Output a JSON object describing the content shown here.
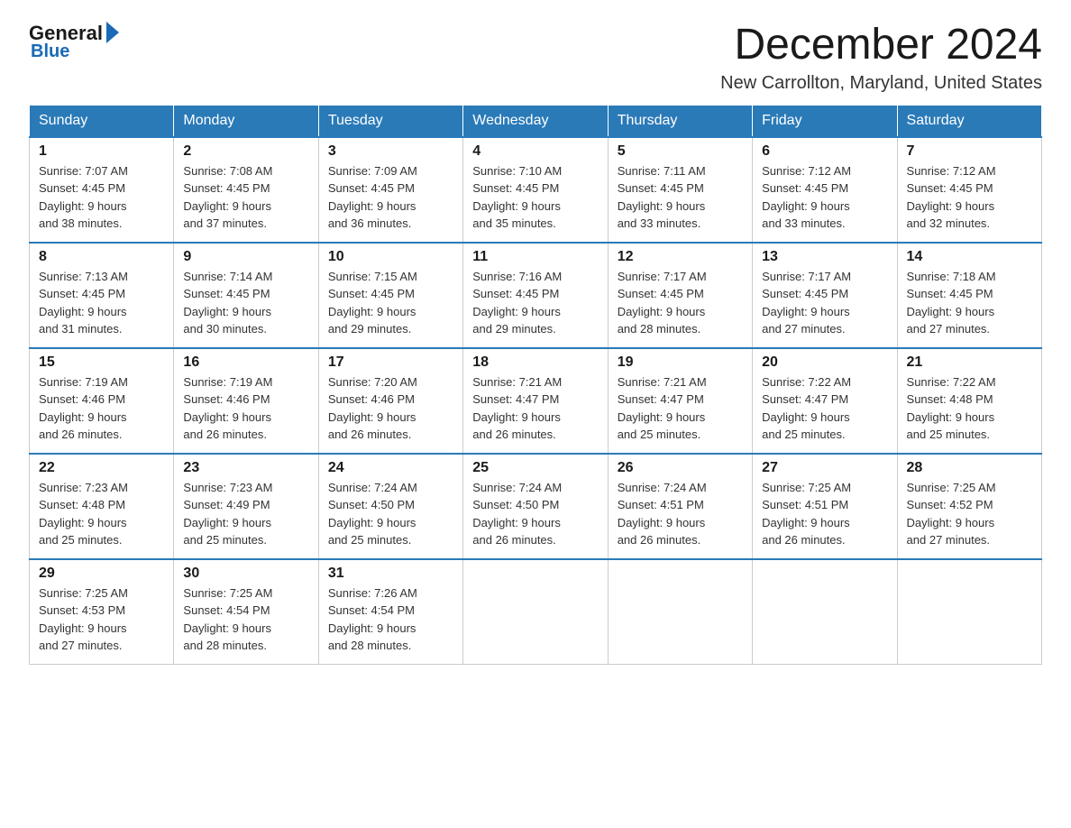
{
  "logo": {
    "general": "General",
    "blue": "Blue"
  },
  "header": {
    "month": "December 2024",
    "location": "New Carrollton, Maryland, United States"
  },
  "weekdays": [
    "Sunday",
    "Monday",
    "Tuesday",
    "Wednesday",
    "Thursday",
    "Friday",
    "Saturday"
  ],
  "weeks": [
    [
      {
        "day": "1",
        "sunrise": "7:07 AM",
        "sunset": "4:45 PM",
        "daylight": "9 hours and 38 minutes."
      },
      {
        "day": "2",
        "sunrise": "7:08 AM",
        "sunset": "4:45 PM",
        "daylight": "9 hours and 37 minutes."
      },
      {
        "day": "3",
        "sunrise": "7:09 AM",
        "sunset": "4:45 PM",
        "daylight": "9 hours and 36 minutes."
      },
      {
        "day": "4",
        "sunrise": "7:10 AM",
        "sunset": "4:45 PM",
        "daylight": "9 hours and 35 minutes."
      },
      {
        "day": "5",
        "sunrise": "7:11 AM",
        "sunset": "4:45 PM",
        "daylight": "9 hours and 33 minutes."
      },
      {
        "day": "6",
        "sunrise": "7:12 AM",
        "sunset": "4:45 PM",
        "daylight": "9 hours and 33 minutes."
      },
      {
        "day": "7",
        "sunrise": "7:12 AM",
        "sunset": "4:45 PM",
        "daylight": "9 hours and 32 minutes."
      }
    ],
    [
      {
        "day": "8",
        "sunrise": "7:13 AM",
        "sunset": "4:45 PM",
        "daylight": "9 hours and 31 minutes."
      },
      {
        "day": "9",
        "sunrise": "7:14 AM",
        "sunset": "4:45 PM",
        "daylight": "9 hours and 30 minutes."
      },
      {
        "day": "10",
        "sunrise": "7:15 AM",
        "sunset": "4:45 PM",
        "daylight": "9 hours and 29 minutes."
      },
      {
        "day": "11",
        "sunrise": "7:16 AM",
        "sunset": "4:45 PM",
        "daylight": "9 hours and 29 minutes."
      },
      {
        "day": "12",
        "sunrise": "7:17 AM",
        "sunset": "4:45 PM",
        "daylight": "9 hours and 28 minutes."
      },
      {
        "day": "13",
        "sunrise": "7:17 AM",
        "sunset": "4:45 PM",
        "daylight": "9 hours and 27 minutes."
      },
      {
        "day": "14",
        "sunrise": "7:18 AM",
        "sunset": "4:45 PM",
        "daylight": "9 hours and 27 minutes."
      }
    ],
    [
      {
        "day": "15",
        "sunrise": "7:19 AM",
        "sunset": "4:46 PM",
        "daylight": "9 hours and 26 minutes."
      },
      {
        "day": "16",
        "sunrise": "7:19 AM",
        "sunset": "4:46 PM",
        "daylight": "9 hours and 26 minutes."
      },
      {
        "day": "17",
        "sunrise": "7:20 AM",
        "sunset": "4:46 PM",
        "daylight": "9 hours and 26 minutes."
      },
      {
        "day": "18",
        "sunrise": "7:21 AM",
        "sunset": "4:47 PM",
        "daylight": "9 hours and 26 minutes."
      },
      {
        "day": "19",
        "sunrise": "7:21 AM",
        "sunset": "4:47 PM",
        "daylight": "9 hours and 25 minutes."
      },
      {
        "day": "20",
        "sunrise": "7:22 AM",
        "sunset": "4:47 PM",
        "daylight": "9 hours and 25 minutes."
      },
      {
        "day": "21",
        "sunrise": "7:22 AM",
        "sunset": "4:48 PM",
        "daylight": "9 hours and 25 minutes."
      }
    ],
    [
      {
        "day": "22",
        "sunrise": "7:23 AM",
        "sunset": "4:48 PM",
        "daylight": "9 hours and 25 minutes."
      },
      {
        "day": "23",
        "sunrise": "7:23 AM",
        "sunset": "4:49 PM",
        "daylight": "9 hours and 25 minutes."
      },
      {
        "day": "24",
        "sunrise": "7:24 AM",
        "sunset": "4:50 PM",
        "daylight": "9 hours and 25 minutes."
      },
      {
        "day": "25",
        "sunrise": "7:24 AM",
        "sunset": "4:50 PM",
        "daylight": "9 hours and 26 minutes."
      },
      {
        "day": "26",
        "sunrise": "7:24 AM",
        "sunset": "4:51 PM",
        "daylight": "9 hours and 26 minutes."
      },
      {
        "day": "27",
        "sunrise": "7:25 AM",
        "sunset": "4:51 PM",
        "daylight": "9 hours and 26 minutes."
      },
      {
        "day": "28",
        "sunrise": "7:25 AM",
        "sunset": "4:52 PM",
        "daylight": "9 hours and 27 minutes."
      }
    ],
    [
      {
        "day": "29",
        "sunrise": "7:25 AM",
        "sunset": "4:53 PM",
        "daylight": "9 hours and 27 minutes."
      },
      {
        "day": "30",
        "sunrise": "7:25 AM",
        "sunset": "4:54 PM",
        "daylight": "9 hours and 28 minutes."
      },
      {
        "day": "31",
        "sunrise": "7:26 AM",
        "sunset": "4:54 PM",
        "daylight": "9 hours and 28 minutes."
      },
      null,
      null,
      null,
      null
    ]
  ],
  "labels": {
    "sunrise": "Sunrise:",
    "sunset": "Sunset:",
    "daylight": "Daylight:"
  },
  "colors": {
    "header_bg": "#2a7ab8",
    "header_text": "#ffffff",
    "border_top": "#2a7ab8"
  }
}
